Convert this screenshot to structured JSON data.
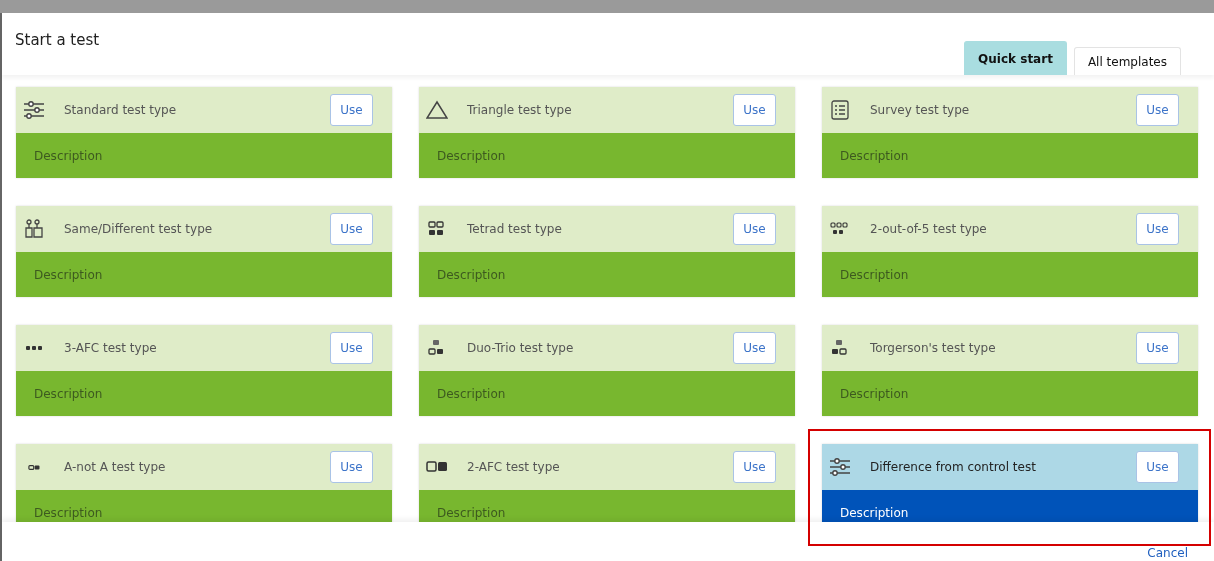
{
  "dialog": {
    "title": "Start a test"
  },
  "tabs": [
    {
      "label": "Quick start",
      "selected": true
    },
    {
      "label": "All templates",
      "selected": false
    }
  ],
  "cards": [
    {
      "kind": "sliders",
      "title": "Standard test type",
      "button": "Use",
      "description": "Description",
      "highlighted": false
    },
    {
      "kind": "triangle",
      "title": "Triangle test type",
      "button": "Use",
      "description": "Description",
      "highlighted": false
    },
    {
      "kind": "survey",
      "title": "Survey test type",
      "button": "Use",
      "description": "Description",
      "highlighted": false
    },
    {
      "kind": "samediff",
      "title": "Same/Different test type",
      "button": "Use",
      "description": "Description",
      "highlighted": false
    },
    {
      "kind": "tetrad",
      "title": "Tetrad test type",
      "button": "Use",
      "description": "Description",
      "highlighted": false
    },
    {
      "kind": "fiveway",
      "title": "2-out-of-5 test type",
      "button": "Use",
      "description": "Description",
      "highlighted": false
    },
    {
      "kind": "threeafc",
      "title": "3-AFC test type",
      "button": "Use",
      "description": "Description",
      "highlighted": false
    },
    {
      "kind": "duotrio",
      "title": "Duo-Trio test type",
      "button": "Use",
      "description": "Description",
      "highlighted": false
    },
    {
      "kind": "torgerson",
      "title": "Torgerson's test type",
      "button": "Use",
      "description": "Description",
      "highlighted": false
    },
    {
      "kind": "anota",
      "title": "A-not A test type",
      "button": "Use",
      "description": "Description",
      "highlighted": false
    },
    {
      "kind": "twoafc",
      "title": "2-AFC test type",
      "button": "Use",
      "description": "Description",
      "highlighted": false
    },
    {
      "kind": "sliders",
      "title": "Difference from control test",
      "button": "Use",
      "description": "Description",
      "highlighted": true
    }
  ],
  "footer": {
    "cancel": "Cancel"
  }
}
